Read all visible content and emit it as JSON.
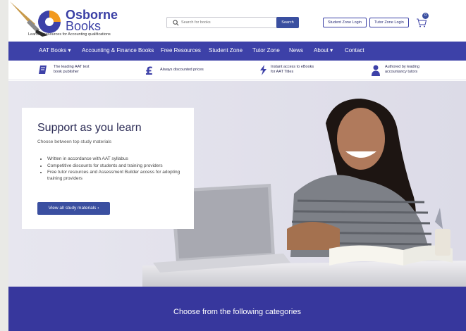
{
  "brand": {
    "name_line1": "Osborne",
    "name_line2": "Books",
    "tagline": "Learning resources for Accounting qualifications"
  },
  "search": {
    "placeholder": "Search for books",
    "button_label": "Search"
  },
  "header_actions": {
    "student_login": "Student Zone Login",
    "tutor_login": "Tutor Zone Login",
    "cart_count": "0"
  },
  "nav": {
    "items": [
      {
        "label": "AAT Books ▾"
      },
      {
        "label": "Accounting & Finance Books"
      },
      {
        "label": "Free Resources"
      },
      {
        "label": "Student Zone"
      },
      {
        "label": "Tutor Zone"
      },
      {
        "label": "News"
      },
      {
        "label": "About ▾"
      },
      {
        "label": "Contact"
      }
    ]
  },
  "usp": [
    {
      "line1": "The leading AAT text",
      "line2": "book publisher",
      "icon": "book-icon"
    },
    {
      "line1": "Always discounted prices",
      "line2": "",
      "icon": "pound-icon"
    },
    {
      "line1": "Instant access to eBooks",
      "line2": "for AAT Titles",
      "icon": "lightning-icon"
    },
    {
      "line1": "Authored by leading",
      "line2": "accountancy tutors",
      "icon": "person-icon"
    }
  ],
  "hero": {
    "title": "Support as you learn",
    "subtitle": "Choose between top study materials",
    "bullets": [
      "Written in accordance with AAT syllabus",
      "Competitive discounts for students and training providers",
      "Free tutor resources and Assessment Builder access for adopting training providers"
    ],
    "button_label": "View all study materials  ›"
  },
  "categories": {
    "title": "Choose from the following categories"
  },
  "colors": {
    "brand_blue": "#3d41a8",
    "button_blue": "#3a4fa0",
    "hero_bg": "#e5e4ee",
    "dark_band": "#37379d"
  }
}
